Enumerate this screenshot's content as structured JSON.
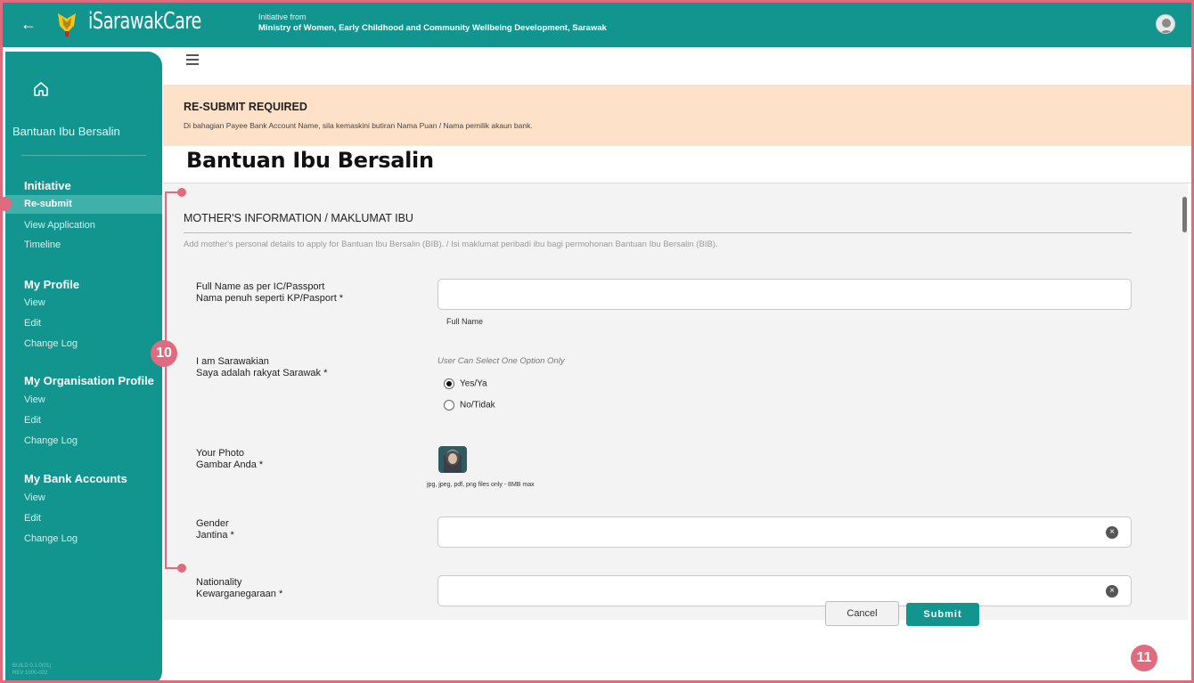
{
  "header": {
    "brand": "iSarawakCare",
    "initiative_from": "Initiative from",
    "ministry": "Ministry of Women, Early Childhood and Community Wellbeing Development, Sarawak"
  },
  "sidebar": {
    "title": "Bantuan Ibu Bersalin",
    "sections": [
      {
        "heading": "Initiative",
        "items": [
          "Re-submit",
          "View Application",
          "Timeline"
        ]
      },
      {
        "heading": "My Profile",
        "items": [
          "View",
          "Edit",
          "Change Log"
        ]
      },
      {
        "heading": "My Organisation Profile",
        "items": [
          "View",
          "Edit",
          "Change Log"
        ]
      },
      {
        "heading": "My Bank Accounts",
        "items": [
          "View",
          "Edit",
          "Change Log"
        ]
      }
    ],
    "active_item": "Re-submit",
    "build_line1": "BUILD 0.1.0(01)",
    "build_line2": "REV 1000-002"
  },
  "alert": {
    "title": "RE-SUBMIT REQUIRED",
    "text": "Di bahagian Payee Bank Account Name, sila kemaskini butiran Nama Puan / Nama pemilik akaun bank."
  },
  "page_title": "Bantuan Ibu Bersalin",
  "form": {
    "section_heading": "MOTHER'S INFORMATION / MAKLUMAT IBU",
    "section_desc": "Add mother's personal details to apply for Bantuan Ibu Bersalin (BIB). / Isi maklumat peribadi ibu bagi permohonan Bantuan Ibu Bersalin (BIB).",
    "full_name": {
      "label_en": "Full Name as per IC/Passport",
      "label_ms": "Nama penuh seperti KP/Pasport *",
      "value": "",
      "hint": "Full Name"
    },
    "sarawakian": {
      "label_en": "I am Sarawakian",
      "label_ms": "Saya adalah rakyat Sarawak *",
      "note": "User Can Select One Option Only",
      "options": [
        "Yes/Ya",
        "No/Tidak"
      ],
      "selected": "Yes/Ya"
    },
    "photo": {
      "label_en": "Your Photo",
      "label_ms": "Gambar Anda *",
      "hint": "jpg, jpeg, pdf, png files only - 8MB max"
    },
    "gender": {
      "label_en": "Gender",
      "label_ms": "Jantina *",
      "value": ""
    },
    "nationality": {
      "label_en": "Nationality",
      "label_ms": "Kewarganegaraan *",
      "value": ""
    }
  },
  "actions": {
    "cancel": "Cancel",
    "submit": "Submit"
  },
  "annotations": {
    "badge_10": "10",
    "badge_11": "11"
  },
  "colors": {
    "primary": "#13958f",
    "alert_bg": "#fde1c8",
    "annotation": "#e06a7e"
  }
}
